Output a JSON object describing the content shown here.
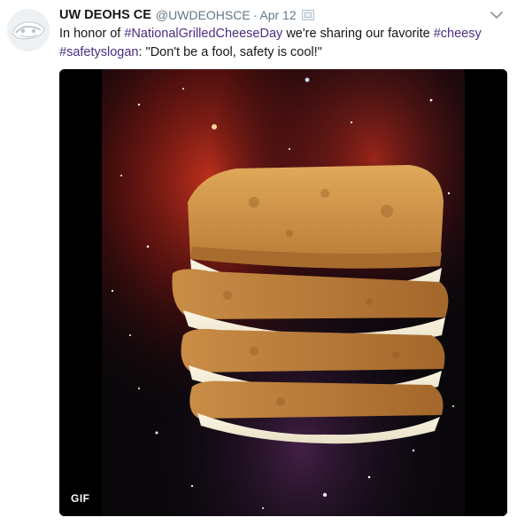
{
  "tweet": {
    "display_name": "UW DEOHS CE",
    "handle": "@UWDEOHSCE",
    "separator": "·",
    "timestamp": "Apr 12",
    "text": {
      "part1": "In honor of ",
      "hashtag1": "#NationalGrilledCheeseDay",
      "part2": " we're sharing our favorite ",
      "hashtag2": "#cheesy",
      "part3": " ",
      "hashtag3": "#safetyslogan",
      "part4": ": \"Don't be a fool, safety is cool!\""
    },
    "media": {
      "badge": "GIF"
    }
  },
  "icons": {
    "avatar": "uw-deohs-logo",
    "caret": "chevron-down-icon",
    "badge": "verified-box-icon"
  },
  "colors": {
    "hashtag": "#4b2e83",
    "meta": "#657786",
    "text": "#14171a"
  }
}
